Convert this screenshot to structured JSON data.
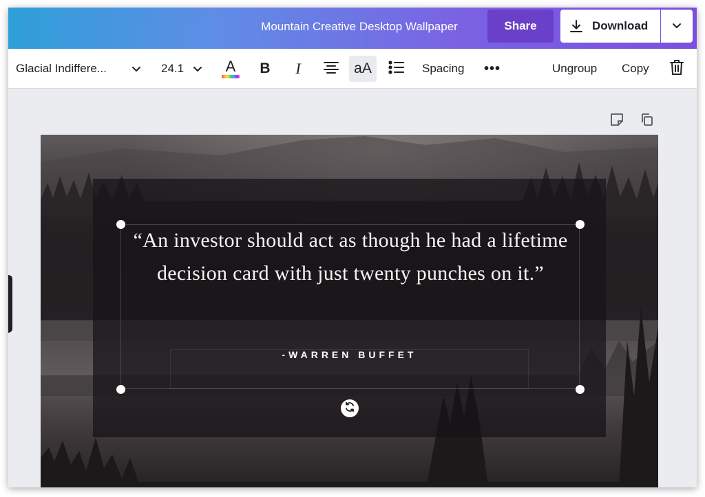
{
  "header": {
    "doc_title": "Mountain Creative Desktop Wallpaper",
    "share_label": "Share",
    "download_label": "Download"
  },
  "toolbar": {
    "font_name": "Glacial Indiffere...",
    "font_size": "24.1",
    "color_letter": "A",
    "bold_label": "B",
    "italic_label": "I",
    "case_label": "aA",
    "spacing_label": "Spacing",
    "more_label": "•••",
    "ungroup_label": "Ungroup",
    "copy_label": "Copy"
  },
  "design": {
    "quote": "“An investor should act as though he had a lifetime decision card with just twenty punches on it.”",
    "author": "-WARREN BUFFET"
  },
  "colors": {
    "header_gradient_start": "#2e9fd8",
    "header_gradient_end": "#7c4fe0",
    "share_button": "#6a40c8",
    "canvas_background": "#ebecef"
  },
  "icons": {
    "download": "download-icon",
    "chevron": "chevron-down-icon",
    "align": "align-center-icon",
    "list": "bullet-list-icon",
    "trash": "trash-icon",
    "note": "sticky-note-icon",
    "duplicate": "duplicate-page-icon",
    "rotate": "rotate-icon"
  }
}
